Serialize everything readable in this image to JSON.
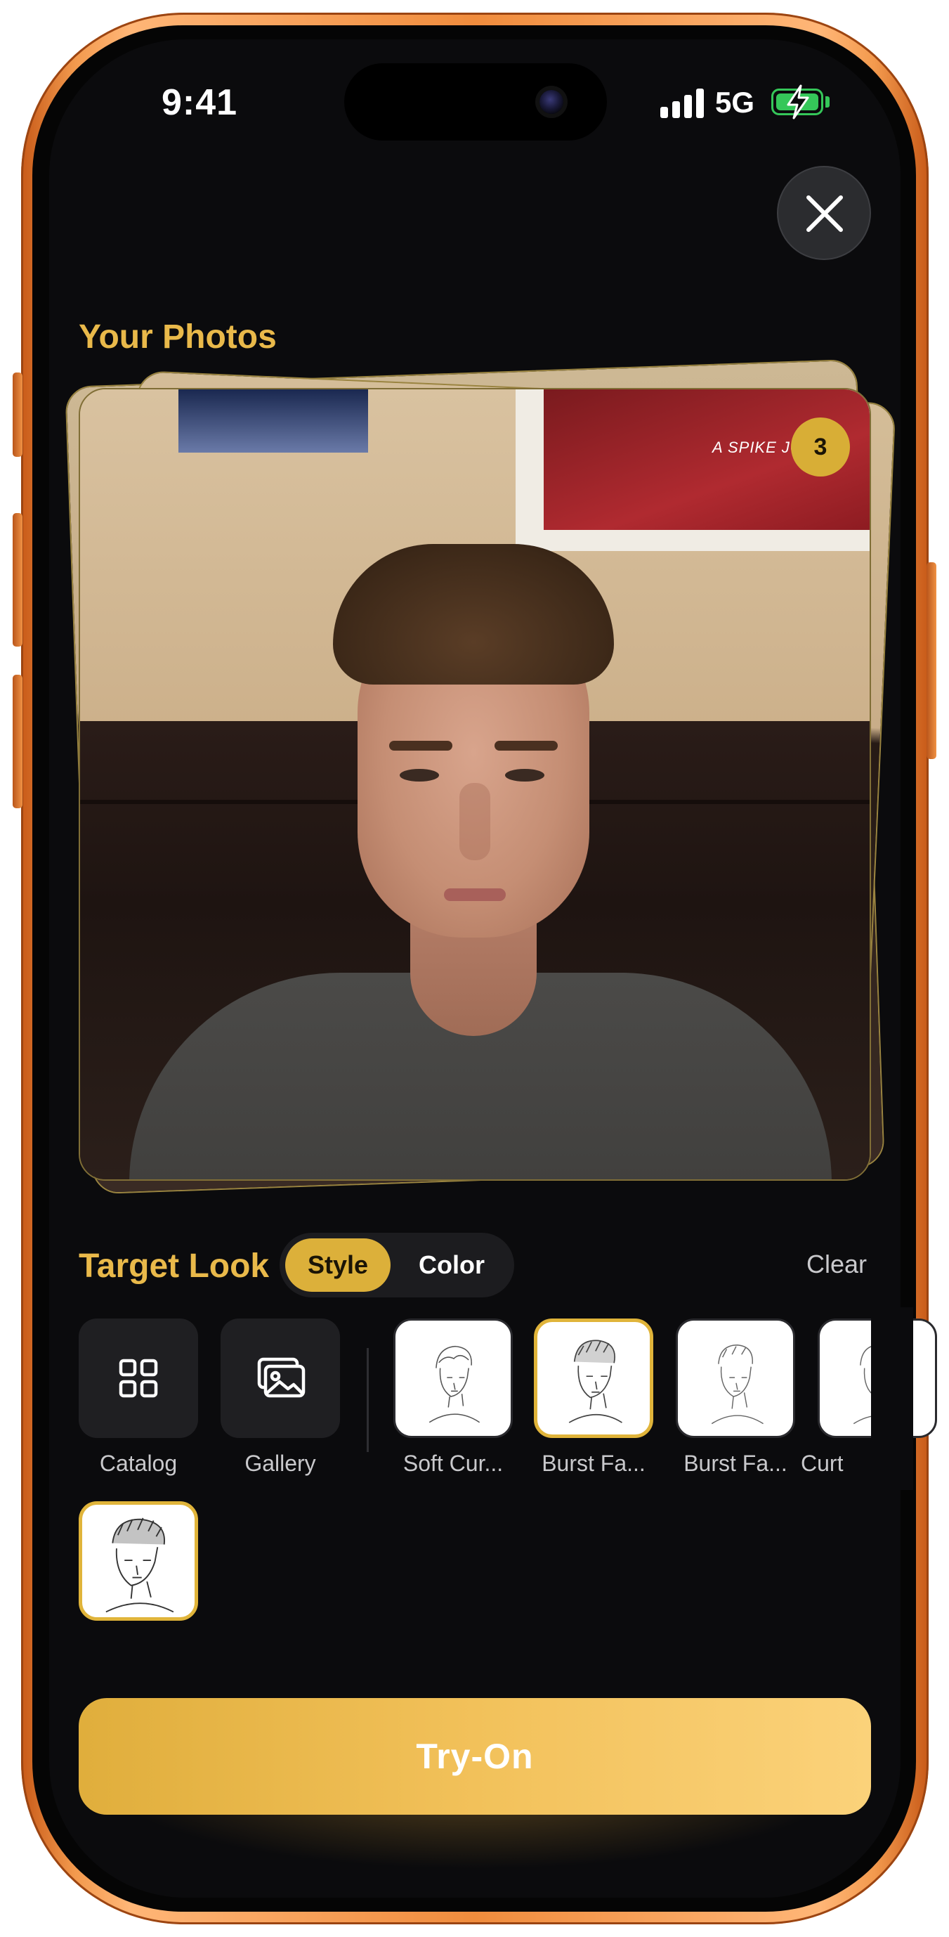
{
  "status_bar": {
    "time": "9:41",
    "network": "5G"
  },
  "close_label": "",
  "photos": {
    "title": "Your Photos",
    "count": "3",
    "poster_caption": "A SPIKE JONZE"
  },
  "target_look": {
    "title": "Target Look",
    "tabs": [
      {
        "label": "Style",
        "active": true
      },
      {
        "label": "Color",
        "active": false
      }
    ],
    "clear_label": "Clear",
    "actions": [
      {
        "label": "Catalog",
        "icon": "grid-icon"
      },
      {
        "label": "Gallery",
        "icon": "gallery-icon"
      }
    ],
    "styles": [
      {
        "label": "Soft Cur...",
        "selected": false
      },
      {
        "label": "Burst Fa...",
        "selected": true
      },
      {
        "label": "Burst Fa...",
        "selected": false
      },
      {
        "label": "Curt",
        "selected": false
      }
    ],
    "selected_preview": {
      "selected": true
    }
  },
  "try_on": {
    "label": "Try-On"
  },
  "colors": {
    "accent": "#e9b94a",
    "background": "#0b0b0d",
    "frame": "#f08c3d"
  }
}
